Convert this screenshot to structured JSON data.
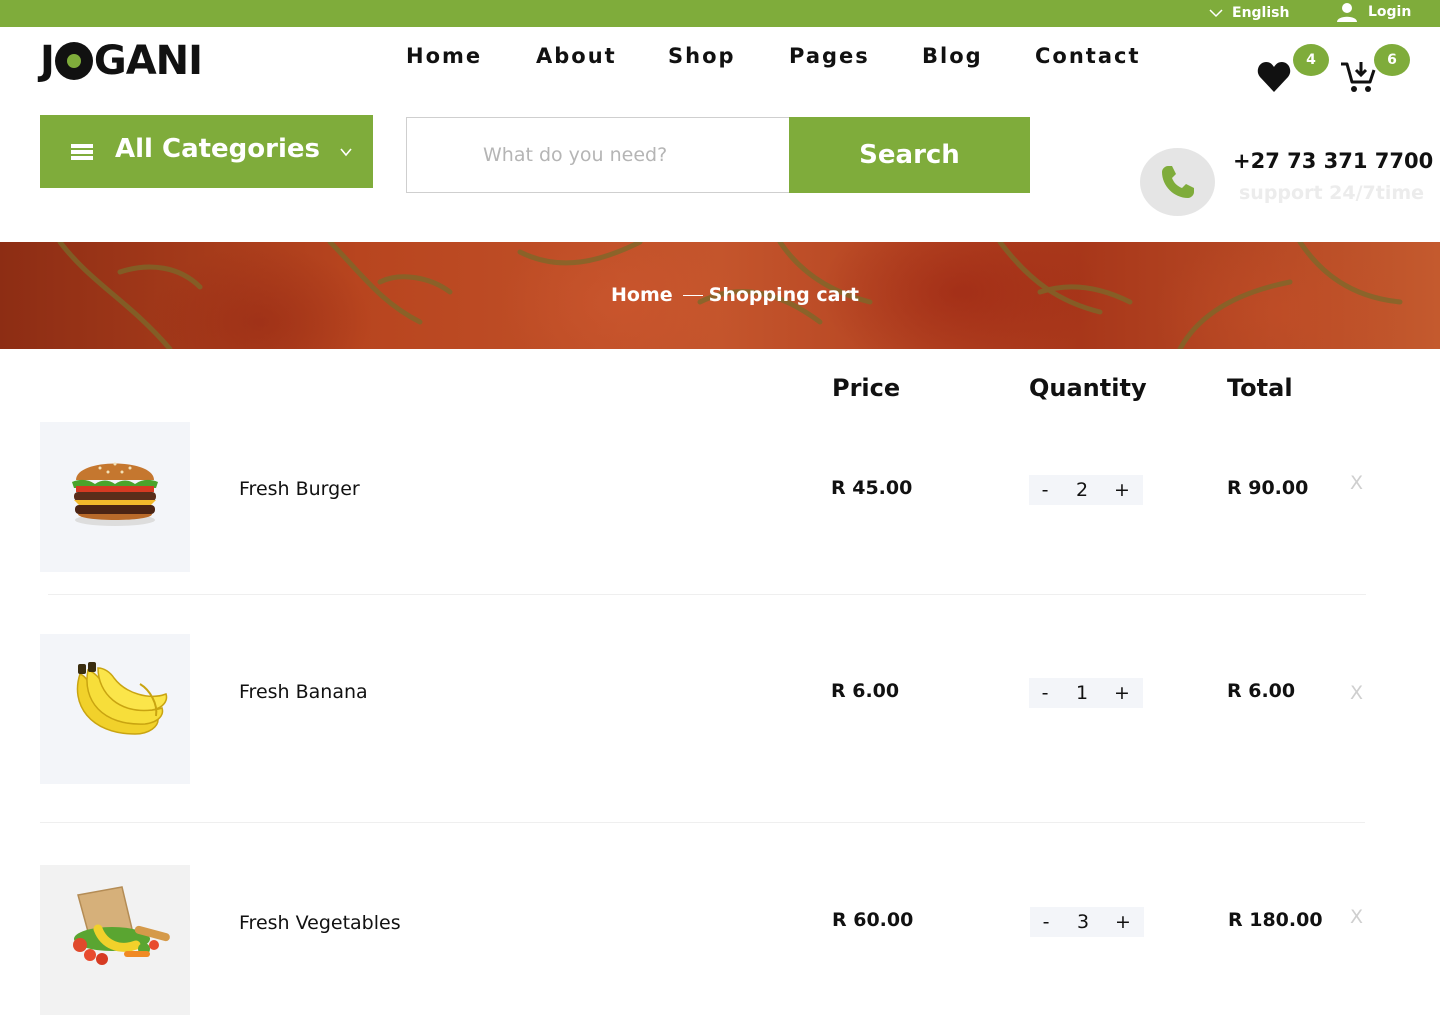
{
  "topbar": {
    "language": "English",
    "login": "Login"
  },
  "header": {
    "logo": "JOGANI",
    "nav": [
      "Home",
      "About",
      "Shop",
      "Pages",
      "Blog",
      "Contact"
    ],
    "wishlist_count": "4",
    "cart_count": "6"
  },
  "search": {
    "categories_label": "All Categories",
    "placeholder": "What do you need?",
    "button_label": "Search"
  },
  "contact": {
    "phone": "+27 73 371 7700",
    "support": "support 24/7time"
  },
  "breadcrumb": {
    "home": "Home",
    "current": "Shopping cart"
  },
  "cart": {
    "headers": {
      "price": "Price",
      "quantity": "Quantity",
      "total": "Total"
    },
    "items": [
      {
        "name": "Fresh Burger",
        "price": "R 45.00",
        "quantity": "2",
        "total": "R 90.00",
        "image": "burger-image"
      },
      {
        "name": "Fresh Banana",
        "price": "R 6.00",
        "quantity": "1",
        "total": "R 6.00",
        "image": "banana-image"
      },
      {
        "name": "Fresh Vegetables",
        "price": "R 60.00",
        "quantity": "3",
        "total": "R 180.00",
        "image": "vegetables-image"
      }
    ],
    "decrement": "-",
    "increment": "+",
    "remove": "X"
  },
  "colors": {
    "accent": "#7fac3b",
    "dark": "#111111",
    "muted": "#cfcfcf",
    "thumb_bg": "#f3f5f9"
  }
}
